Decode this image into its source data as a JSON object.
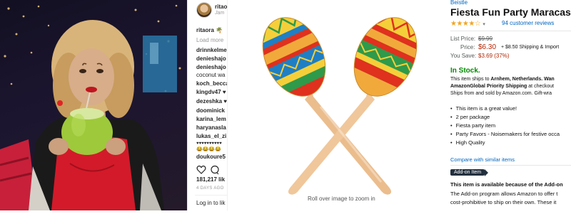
{
  "instagram": {
    "username": "ritaora",
    "subtitle": "Jam",
    "caption_user": "ritaora",
    "caption_emoji": "🌴",
    "load_more": "Load more",
    "comments": [
      {
        "user": "drinnkelme",
        "text": ""
      },
      {
        "user": "denieshajo",
        "text": ""
      },
      {
        "user": "denieshajo",
        "text": ""
      },
      {
        "user": "",
        "text": "coconut wa"
      },
      {
        "user": "koch_becca",
        "text": ""
      },
      {
        "user": "kingdv47",
        "text": "♥"
      },
      {
        "user": "dezeshka",
        "text": "♥"
      },
      {
        "user": "doominick",
        "text": ""
      },
      {
        "user": "karina_lem",
        "text": ""
      },
      {
        "user": "haryanasla",
        "text": ""
      },
      {
        "user": "lukas_el_zi",
        "text": ""
      },
      {
        "user": "",
        "text": "♥♥♥♥♥♥♥♥♥♥"
      },
      {
        "user": "",
        "text": "😂😂😂😂"
      },
      {
        "user": "doukoure5",
        "text": ""
      }
    ],
    "likes": "181,217 lik",
    "time_ago": "4 DAYS AGO",
    "login": "Log in to lik"
  },
  "product_image": {
    "zoom_hint": "Roll over image to zoom in",
    "colors": {
      "body": "#f2a93b",
      "handle": "#e8b98a",
      "red": "#e0301e",
      "green": "#2e9a4a",
      "blue": "#1f7fc4",
      "yellow": "#f5cf3a"
    }
  },
  "amazon": {
    "brand": "Beistle",
    "title": "Fiesta Fun Party Maracas (2/",
    "rating": 4,
    "stars_text": "★★★★☆",
    "reviews": "94 customer reviews",
    "list_price_label": "List Price:",
    "list_price": "$9.99",
    "price_label": "Price:",
    "price": "$6.30",
    "shipping": "+ $8.50 Shipping & Import",
    "save_label": "You Save:",
    "save": "$3.69 (37%)",
    "stock": "In Stock.",
    "ships_line1_prefix": "This item ships to ",
    "ships_line1_bold": "Arnhem, Netherlands. Wan",
    "ships_line2_bold": "AmazonGlobal Priority Shipping",
    "ships_line2_suffix": " at checkout",
    "ships_line3": "Ships from and sold by Amazon.com. Gift-wra",
    "bullets": [
      "This item is a great value!",
      "2 per package",
      "Fiesta party item",
      "Party Favors - Noisemakers for festive occa",
      "High Quality"
    ],
    "compare": "Compare with similar items",
    "addon_badge": "Add-on Item",
    "addon_line1": "This item is available because of the Add-on",
    "addon_line2": "The Add-on program allows Amazon to offer t",
    "addon_line3": "cost-prohibitive to ship on their own. These it"
  }
}
